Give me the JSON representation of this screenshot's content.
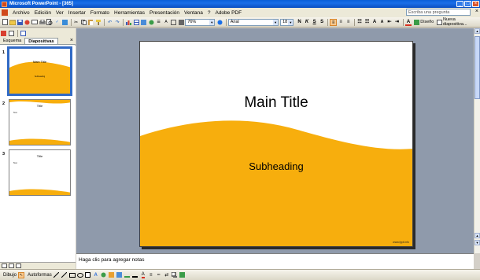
{
  "window": {
    "title": "Microsoft PowerPoint - [365]"
  },
  "menubar": {
    "items": [
      "Archivo",
      "Edición",
      "Ver",
      "Insertar",
      "Formato",
      "Herramientas",
      "Presentación",
      "Ventana",
      "?",
      "Adobe PDF"
    ],
    "help_placeholder": "Escriba una pregunta"
  },
  "toolbar": {
    "zoom": "76%",
    "font": "Arial",
    "font_size": "18",
    "diseno_label": "Diseño",
    "nueva_diapositiva_label": "Nueva diapositiva..."
  },
  "left_pane": {
    "tabs": [
      "Esquema",
      "Diapositivas"
    ],
    "active_tab": "Diapositivas",
    "thumbnails": [
      {
        "number": "1",
        "title": "Main Title",
        "subtitle": "Subheading"
      },
      {
        "number": "2",
        "title": "Title",
        "bullet": "Text"
      },
      {
        "number": "3",
        "title": "Title",
        "bullet": "Text"
      }
    ]
  },
  "slide": {
    "title": "Main Title",
    "subheading": "Subheading",
    "footer": "www.fppt.info",
    "accent_color": "#f7ae0d"
  },
  "notes": {
    "placeholder": "Haga clic para agregar notas"
  },
  "drawbar": {
    "dibujo_label": "Dibujo",
    "autoformas_label": "Autoformas"
  },
  "colors": {
    "titlebar": "#0a5fd8",
    "slide_accent": "#f7ae0d",
    "editarea_bg": "#8f9aab"
  }
}
